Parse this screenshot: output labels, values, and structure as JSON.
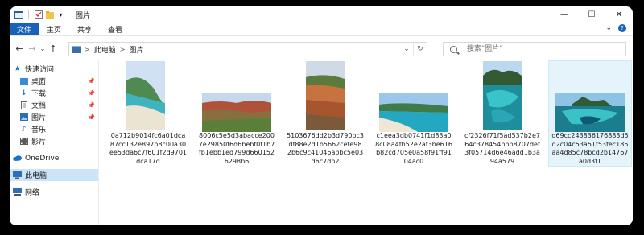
{
  "window": {
    "title": "图片"
  },
  "controls": {
    "minimize": "—",
    "maximize": "☐",
    "close": "✕"
  },
  "ribbon": {
    "file": "文件",
    "home": "主页",
    "share": "共享",
    "view": "查看",
    "expand": "⌄"
  },
  "nav": {
    "back": "←",
    "forward": "→",
    "recent": "⌄",
    "up": "↑",
    "dropdown": "⌄",
    "refresh": "↻"
  },
  "address": {
    "sep": ">",
    "crumbs": [
      "此电脑",
      "图片"
    ]
  },
  "search": {
    "placeholder": "搜索\"图片\""
  },
  "sidebar": {
    "quick_access": "快速访问",
    "desktop": "桌面",
    "downloads": "下载",
    "documents": "文档",
    "pictures": "图片",
    "music": "音乐",
    "videos": "影片",
    "onedrive": "OneDrive",
    "this_pc": "此电脑",
    "network": "网络",
    "pin": "📌"
  },
  "files": [
    {
      "name": "0a712b9014fc6a01dca87cc132e897b8c00a30ee53da6c7f601f2d9701dca17d"
    },
    {
      "name": "8006c5e5d3abacce2007e29850f6d6bebf0f1b7fb1ebb1ed799d6601526298b6"
    },
    {
      "name": "5103676dd2b3d790bc3df88e2d1b5662cefe982b6c9c41046abbc5e03d6c7db2"
    },
    {
      "name": "c1eea3db0741f1d83a08c08a4fb52e2af3be616b82cd705e0a58f91ff9104ac0"
    },
    {
      "name": "cf2326f71f5ad537b2e764c378454bbb8707def3f05714d6e46add1b3a94a579"
    },
    {
      "name": "d69cc243836176883d5d2c04c53a51f53fec185aa4d85c78bcd2b14767a0d3f1"
    }
  ]
}
